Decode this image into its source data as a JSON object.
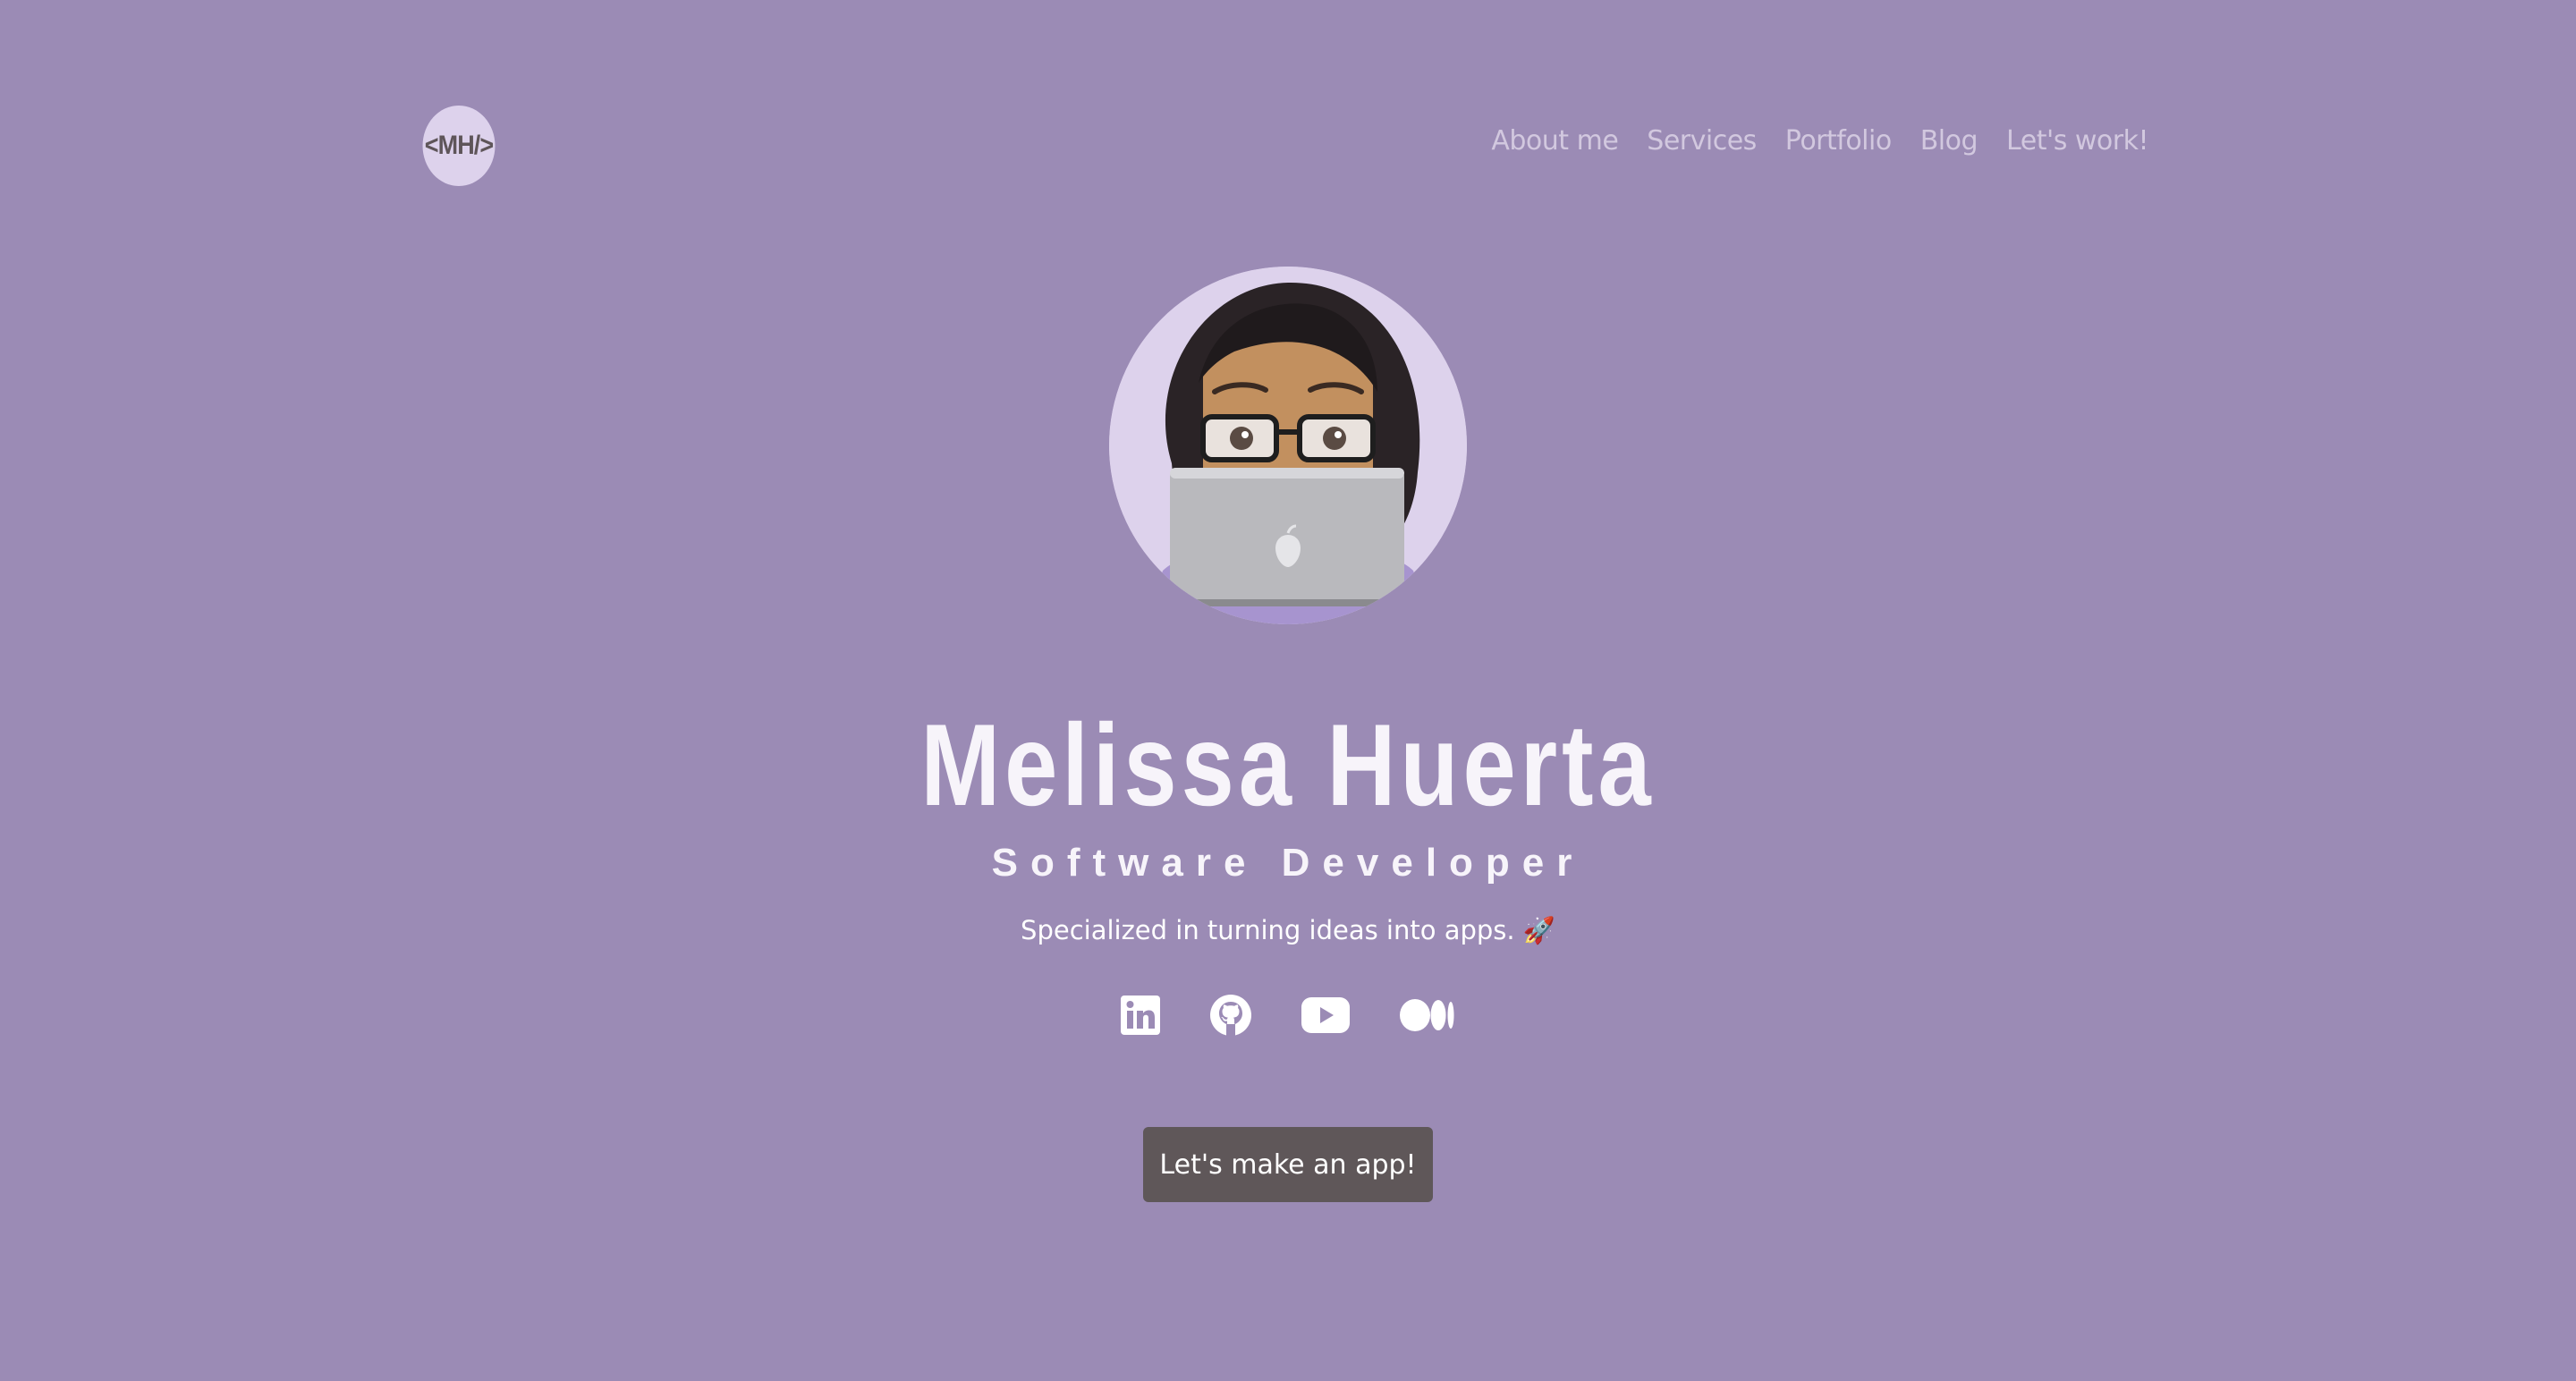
{
  "logo": {
    "text": "<MH/>"
  },
  "nav": {
    "items": [
      "About me",
      "Services",
      "Portfolio",
      "Blog",
      "Let's work!"
    ]
  },
  "hero": {
    "name": "Melissa Huerta",
    "role": "Software Developer",
    "tagline": "Specialized in turning ideas into apps. 🚀"
  },
  "socials": [
    {
      "icon": "linkedin-icon"
    },
    {
      "icon": "github-icon"
    },
    {
      "icon": "youtube-icon"
    },
    {
      "icon": "medium-icon"
    }
  ],
  "cta": {
    "label": "Let's make an app!"
  },
  "colors": {
    "background": "#9b8bb5",
    "logo_bg": "#ddd2ec",
    "nav_text": "#d2c8df",
    "heading": "#f7f4fa",
    "button_bg": "#5f5759"
  }
}
